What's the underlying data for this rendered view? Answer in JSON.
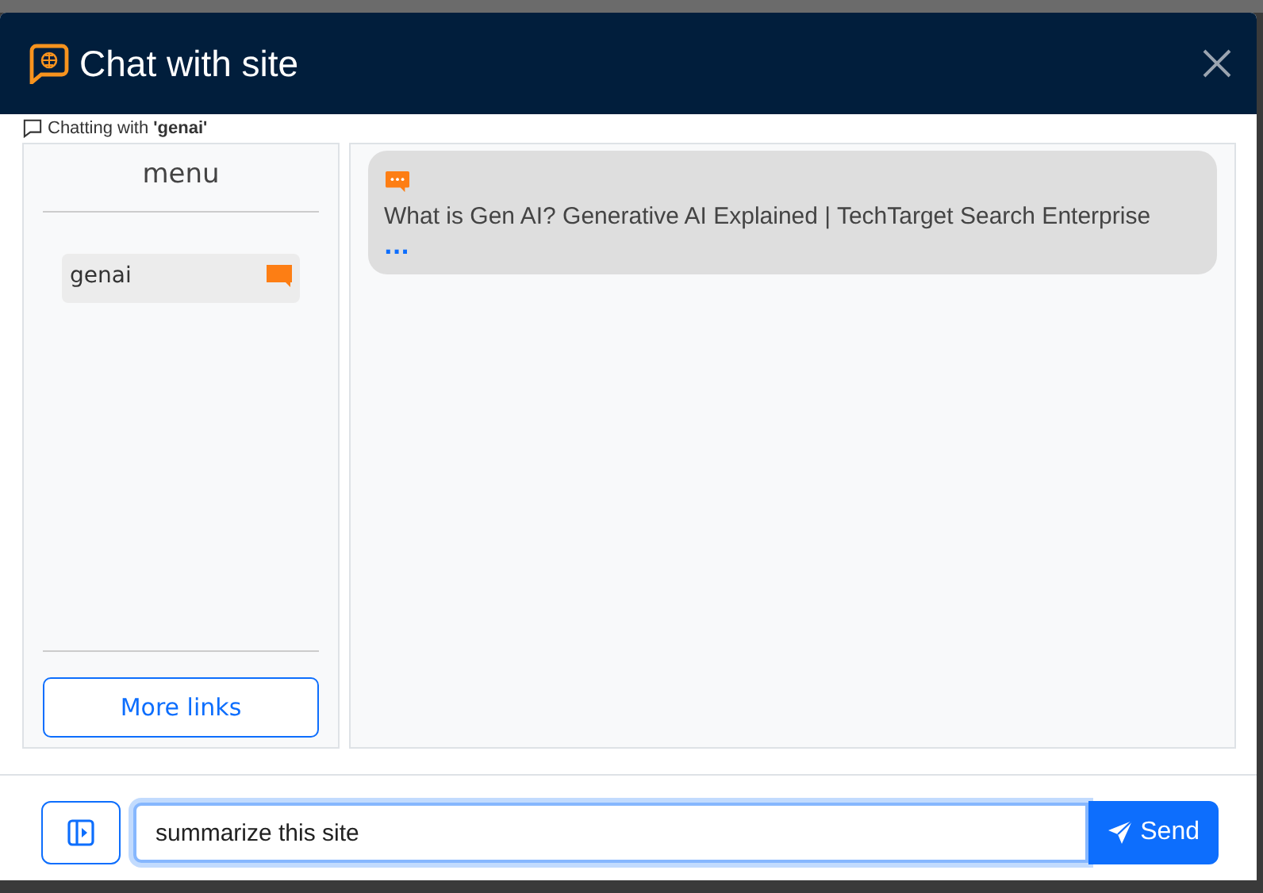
{
  "window": {
    "title": "Chat with site"
  },
  "chatting_with": {
    "label": "Chatting with ",
    "site": "'genai'"
  },
  "menu": {
    "title": "menu",
    "items": [
      {
        "label": "genai",
        "selected": true
      }
    ],
    "more_links": "More links"
  },
  "messages": [
    {
      "kind": "bot",
      "text": "What is Gen AI? Generative AI Explained | TechTarget Search Enterprise",
      "more": "..."
    }
  ],
  "composer": {
    "value": "summarize this site",
    "send": "Send"
  }
}
